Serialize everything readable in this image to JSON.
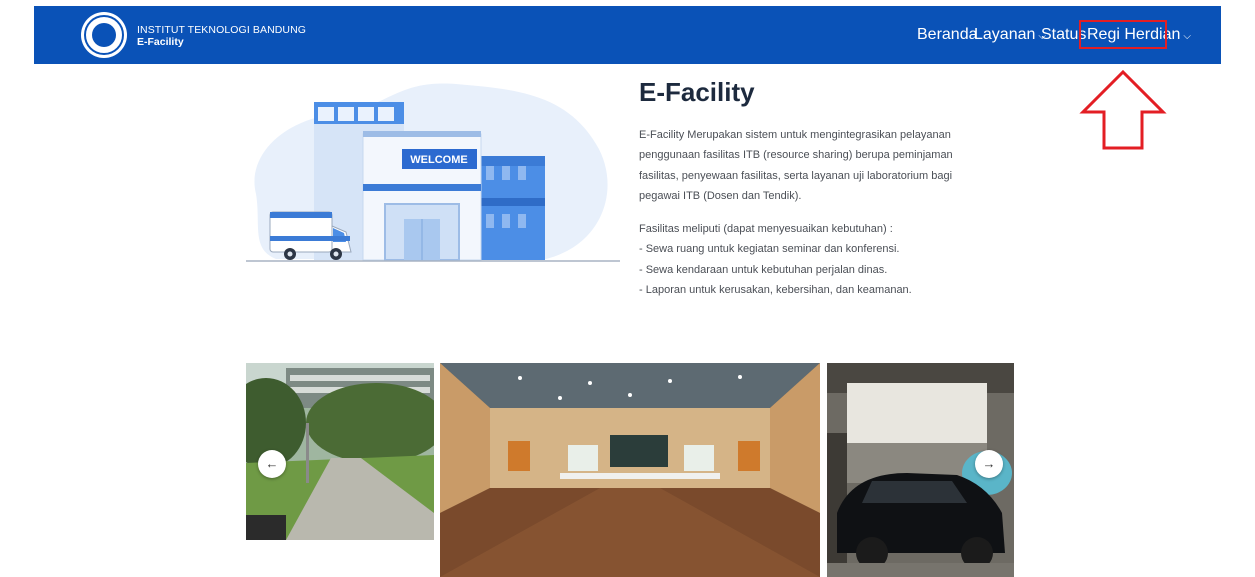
{
  "header": {
    "institution": "INSTITUT TEKNOLOGI BANDUNG",
    "app_name": "E-Facility",
    "nav": {
      "home": "Beranda",
      "services": "Layanan",
      "status": "Status",
      "user": "Regi Herdian"
    }
  },
  "hero": {
    "illustration_sign": "WELCOME",
    "title": "E-Facility",
    "description": "E-Facility Merupakan sistem untuk mengintegrasikan pelayanan penggunaan fasilitas ITB (resource sharing) berupa peminjaman fasilitas, penyewaan fasilitas, serta layanan uji laboratorium bagi pegawai ITB (Dosen dan Tendik).",
    "facilities_intro": "Fasilitas meliputi (dapat menyesuaikan kebutuhan) :",
    "facilities": [
      "- Sewa ruang untuk kegiatan seminar dan konferensi.",
      "- Sewa kendaraan untuk kebutuhan perjalan dinas.",
      "- Laporan untuk kerusakan, kebersihan, dan keamanan."
    ]
  },
  "carousel": {
    "prev_icon": "←",
    "next_icon": "→"
  },
  "colors": {
    "navbar": "#0a52b7",
    "highlight": "#e31e24",
    "title": "#1d2a3e"
  }
}
